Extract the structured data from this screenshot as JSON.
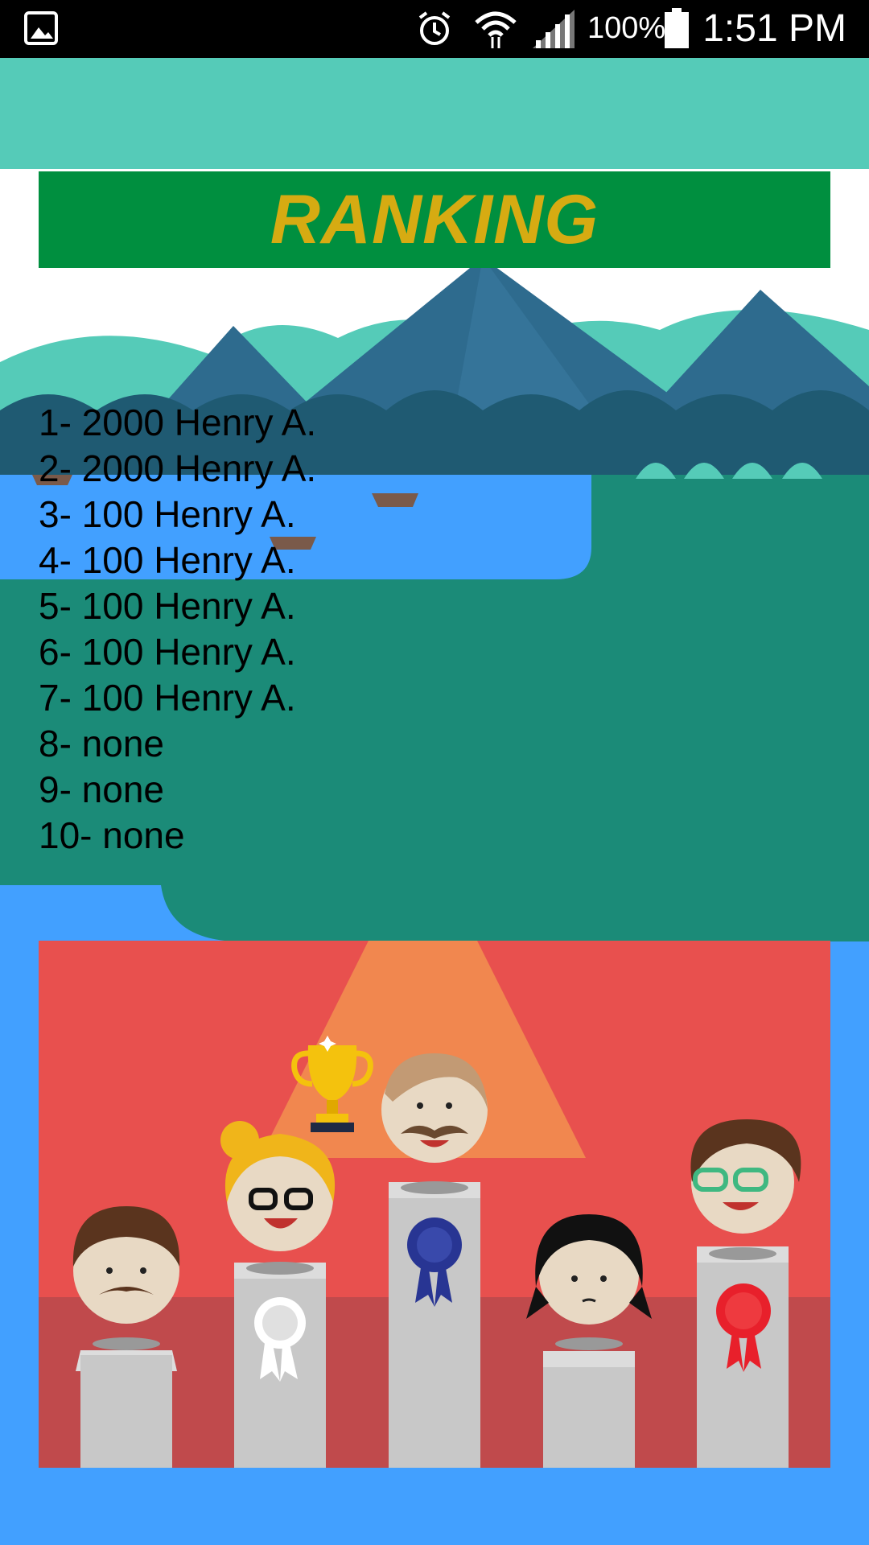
{
  "status_bar": {
    "battery_percent": "100%",
    "time": "1:51 PM",
    "icons": [
      "gallery-icon",
      "alarm-icon",
      "wifi-icon",
      "signal-icon",
      "battery-icon"
    ]
  },
  "banner": {
    "title": "RANKING"
  },
  "ranking": [
    "1- 2000 Henry A.",
    "2- 2000 Henry A.",
    "3- 100 Henry A.",
    "4- 100 Henry A.",
    "5- 100 Henry A.",
    "6- 100 Henry A.",
    "7- 100 Henry A.",
    "8- none",
    "9- none",
    "10- none"
  ],
  "colors": {
    "status_bar": "#000000",
    "app_bar": "#55cbb8",
    "banner": "#008f3f",
    "banner_text": "#d6ab12",
    "lake": "#42a0ff",
    "field": "#1b8b78",
    "mountain": "#2e6b8e",
    "podium_background": "#e8504e",
    "podium_floor": "#c04a4c",
    "pedestal": "#c8c8c8"
  }
}
